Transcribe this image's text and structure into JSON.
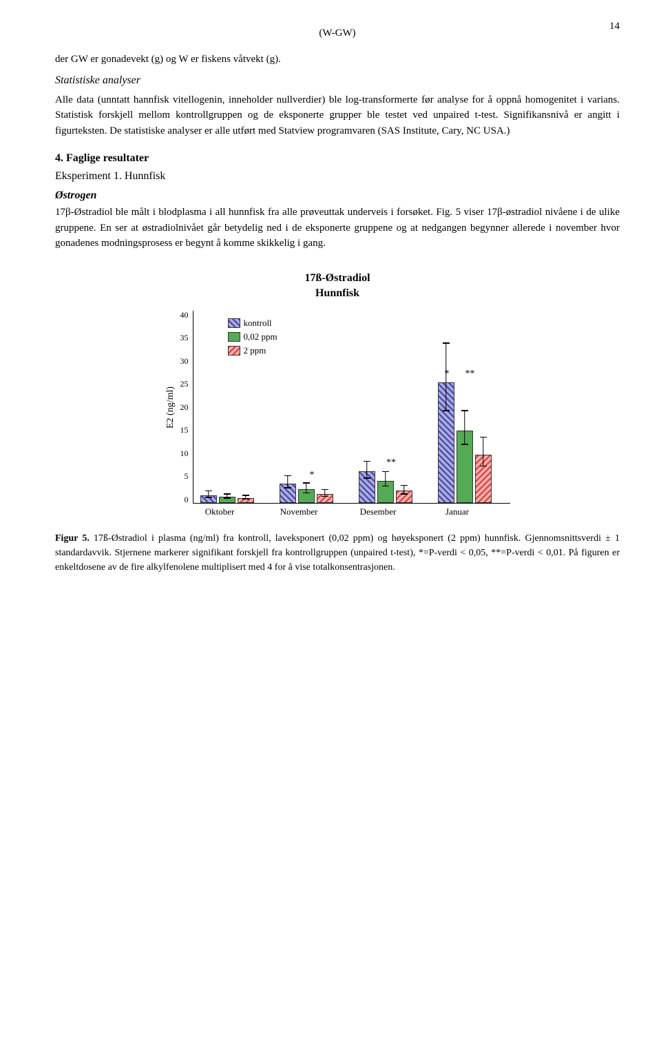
{
  "page": {
    "number": "14",
    "formula": "(W-GW)",
    "paragraphs": {
      "intro1": "der GW er gonadevekt (g) og W er fiskens våtvekt (g).",
      "section_title": "Statistiske analyser",
      "para1": "Alle data (unntatt hannfisk vitellogenin, inneholder nullverdier) ble log-transformerte før analyse for å oppnå homogenitet i varians. Statistisk forskjell mellom kontrollgruppen og de eksponerte grupper ble testet ved unpaired t-test. Signifikansnivå er angitt i figurteksten. De statistiske analyser er alle utført med Statview programvaren (SAS Institute, Cary, NC USA.)",
      "section4": "4.    Faglige resultater",
      "eksperiment1": "Eksperiment 1. Hunnfisk",
      "ostrogen": "Østrogen",
      "para2": "17β-Østradiol ble målt i blodplasma i all hunnfisk fra alle prøveuttak underveis i forsøket. Fig. 5 viser 17β-østradiol nivåene i de ulike gruppene. En ser at østradiolnivået går betydelig ned i de eksponerte gruppene og at nedgangen begynner allerede i november hvor gonadenes modningsprosess er begynt å komme skikkelig i gang."
    },
    "chart": {
      "title": "17ß-Østradiol",
      "subtitle": "Hunnfisk",
      "y_label": "E2 (ng/ml)",
      "y_ticks": [
        "0",
        "5",
        "10",
        "15",
        "20",
        "25",
        "30",
        "35",
        "40"
      ],
      "legend": {
        "kontroll": "kontroll",
        "ppm002": "0,02 ppm",
        "ppm2": "2 ppm"
      },
      "groups": [
        {
          "label": "Oktober",
          "bars": [
            {
              "type": "kontroll",
              "value": 1.5,
              "error_up": 0.8,
              "error_down": 0.5
            },
            {
              "type": "002ppm",
              "value": 1.2,
              "error_up": 0.5,
              "error_down": 0.4
            },
            {
              "type": "2ppm",
              "value": 1.0,
              "error_up": 0.4,
              "error_down": 0.3
            }
          ],
          "significance": ""
        },
        {
          "label": "November",
          "bars": [
            {
              "type": "kontroll",
              "value": 4.0,
              "error_up": 1.5,
              "error_down": 1.0
            },
            {
              "type": "002ppm",
              "value": 2.8,
              "error_up": 1.2,
              "error_down": 0.9
            },
            {
              "type": "2ppm",
              "value": 1.8,
              "error_up": 0.8,
              "error_down": 0.6
            }
          ],
          "significance": "*"
        },
        {
          "label": "Desember",
          "bars": [
            {
              "type": "kontroll",
              "value": 6.5,
              "error_up": 2.0,
              "error_down": 1.5
            },
            {
              "type": "002ppm",
              "value": 4.5,
              "error_up": 1.8,
              "error_down": 1.2
            },
            {
              "type": "2ppm",
              "value": 2.5,
              "error_up": 1.0,
              "error_down": 0.8
            }
          ],
          "significance": "**"
        },
        {
          "label": "Januar",
          "bars": [
            {
              "type": "kontroll",
              "value": 25.0,
              "error_up": 8.0,
              "error_down": 6.0
            },
            {
              "type": "002ppm",
              "value": 15.0,
              "error_up": 4.0,
              "error_down": 3.0
            },
            {
              "type": "2ppm",
              "value": 10.0,
              "error_up": 3.5,
              "error_down": 2.5
            }
          ],
          "significance_kontroll": "*",
          "significance_002": "**"
        }
      ],
      "max_value": 40
    },
    "figur": {
      "label": "Figur 5.",
      "text": " 17ß-Østradiol i plasma (ng/ml) fra kontroll, laveksponert (0,02 ppm) og høyeksponert (2 ppm) hunnfisk. Gjennomsnittsverdi ± 1 standardavvik. Stjernene markerer signifikant forskjell fra kontrollgruppen (unpaired t-test), *=P-verdi < 0,05, **=P-verdi < 0,01. På figuren er enkeltdosene av de fire alkylfenolene multiplisert med 4 for å vise totalkonsentrasjonen."
    }
  }
}
